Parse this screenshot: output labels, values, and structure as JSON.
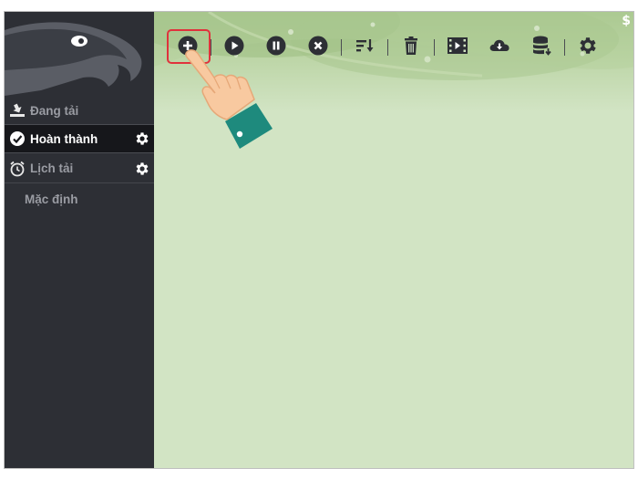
{
  "sidebar": {
    "items": [
      {
        "label": "Đang tải",
        "icon": "download-tray-icon",
        "active": false
      },
      {
        "label": "Hoàn thành",
        "icon": "check-circle-icon",
        "active": true,
        "has_settings": true
      },
      {
        "label": "Lịch tải",
        "icon": "alarm-clock-icon",
        "active": false,
        "has_settings": true
      },
      {
        "label": "Mặc định",
        "active": false,
        "sub": true
      }
    ]
  },
  "toolbar": {
    "buttons": [
      {
        "icon": "add-circle-icon",
        "highlighted": true
      },
      {
        "icon": "play-circle-icon"
      },
      {
        "icon": "pause-circle-icon"
      },
      {
        "icon": "stop-circle-icon"
      },
      {
        "icon": "sort-icon"
      },
      {
        "icon": "trash-icon"
      },
      {
        "icon": "video-film-icon"
      },
      {
        "icon": "cloud-download-icon"
      },
      {
        "icon": "database-icon"
      },
      {
        "icon": "gear-icon"
      }
    ]
  },
  "header": {
    "corner_symbol": "$"
  },
  "colors": {
    "sidebar_bg": "#2d2f35",
    "active_item_bg": "#16171b",
    "main_bg": "#d2e4c4",
    "highlight": "#e0323c",
    "icon": "#2d2f35"
  }
}
